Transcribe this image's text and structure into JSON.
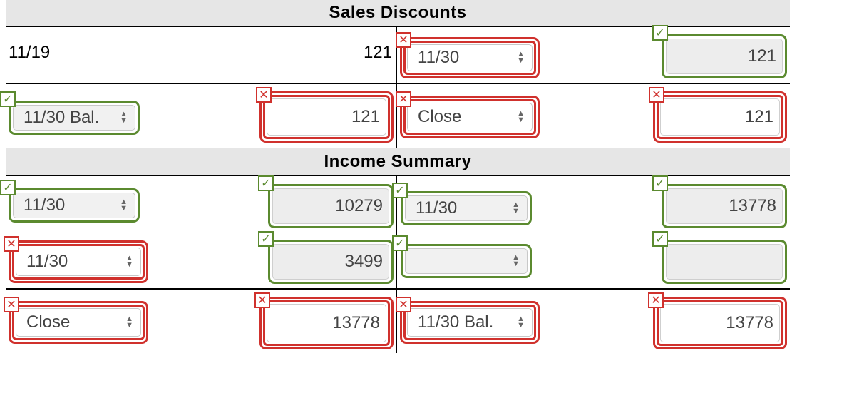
{
  "sections": {
    "sales_discounts_title": "Sales Discounts",
    "income_summary_title": "Income Summary"
  },
  "sales_discounts": {
    "row1": {
      "date": "11/19",
      "amount": "121",
      "right_date": "11/30",
      "right_amount": "121"
    },
    "row2": {
      "left_date": "11/30 Bal.",
      "left_amount": "121",
      "right_date": "Close",
      "right_amount": "121"
    }
  },
  "income_summary": {
    "row1": {
      "left_date": "11/30",
      "left_amount": "10279",
      "right_date": "11/30",
      "right_amount": "13778"
    },
    "row2": {
      "left_date": "11/30",
      "left_amount": "3499",
      "right_date": "",
      "right_amount": ""
    },
    "row3": {
      "left_date": "Close",
      "left_amount": "13778",
      "right_date": "11/30 Bal.",
      "right_amount": "13778"
    }
  },
  "marks": {
    "ok_symbol": "✓",
    "bad_symbol": "✕"
  },
  "colors": {
    "correct": "#5b8a2f",
    "incorrect": "#d0312d",
    "header_bg": "#e6e6e6"
  }
}
